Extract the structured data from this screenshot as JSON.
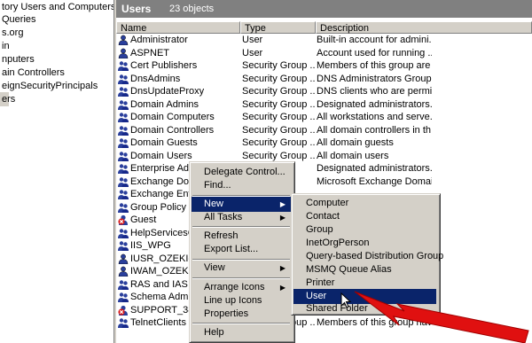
{
  "tree": {
    "items": [
      "tory Users and Computers [ex",
      "Queries",
      "s.org",
      "in",
      "nputers",
      "ain Controllers",
      "eignSecurityPrincipals",
      "ers"
    ]
  },
  "title": {
    "name": "Users",
    "count": "23 objects"
  },
  "columns": [
    "Name",
    "Type",
    "Description"
  ],
  "rows": [
    {
      "name": "Administrator",
      "type": "User",
      "desc": "Built-in account for admini...",
      "icon": "user-icon"
    },
    {
      "name": "ASPNET",
      "type": "User",
      "desc": "Account used for running ...",
      "icon": "user-icon"
    },
    {
      "name": "Cert Publishers",
      "type": "Security Group ...",
      "desc": "Members of this group are ...",
      "icon": "group-icon"
    },
    {
      "name": "DnsAdmins",
      "type": "Security Group ...",
      "desc": "DNS Administrators Group",
      "icon": "group-icon"
    },
    {
      "name": "DnsUpdateProxy",
      "type": "Security Group ...",
      "desc": "DNS clients who are permi...",
      "icon": "group-icon"
    },
    {
      "name": "Domain Admins",
      "type": "Security Group ...",
      "desc": "Designated administrators...",
      "icon": "group-icon"
    },
    {
      "name": "Domain Computers",
      "type": "Security Group ...",
      "desc": "All workstations and serve...",
      "icon": "group-icon"
    },
    {
      "name": "Domain Controllers",
      "type": "Security Group ...",
      "desc": "All domain controllers in th...",
      "icon": "group-icon"
    },
    {
      "name": "Domain Guests",
      "type": "Security Group ...",
      "desc": "All domain guests",
      "icon": "group-icon"
    },
    {
      "name": "Domain Users",
      "type": "Security Group ...",
      "desc": "All domain users",
      "icon": "group-icon"
    },
    {
      "name": "Enterprise Admi",
      "type": "",
      "desc": "Designated administrators...",
      "icon": "group-icon"
    },
    {
      "name": "Exchange Doma",
      "type": "",
      "desc": "Microsoft Exchange Domai...",
      "icon": "group-icon"
    },
    {
      "name": "Exchange Enter",
      "type": "",
      "desc": "",
      "icon": "group-icon"
    },
    {
      "name": "Group Policy Cre",
      "type": "",
      "desc": "",
      "icon": "group-icon"
    },
    {
      "name": "Guest",
      "type": "",
      "desc": "",
      "icon": "disabled-user-icon"
    },
    {
      "name": "HelpServicesGro",
      "type": "",
      "desc": "",
      "icon": "group-icon"
    },
    {
      "name": "IIS_WPG",
      "type": "",
      "desc": "",
      "icon": "group-icon"
    },
    {
      "name": "IUSR_OZEKI-EZ",
      "type": "",
      "desc": "",
      "icon": "user-icon"
    },
    {
      "name": "IWAM_OZEKI-EZ",
      "type": "",
      "desc": "",
      "icon": "user-icon"
    },
    {
      "name": "RAS and IAS Se",
      "type": "",
      "desc": "",
      "icon": "group-icon"
    },
    {
      "name": "Schema Admins",
      "type": "",
      "desc": "",
      "icon": "group-icon"
    },
    {
      "name": "SUPPORT_3889",
      "type": "",
      "desc": "",
      "icon": "disabled-user-icon"
    },
    {
      "name": "TelnetClients",
      "type": "Security Group ...",
      "desc": "Members of this group hav...",
      "icon": "group-icon"
    }
  ],
  "context_menu": {
    "items": [
      "Delegate Control...",
      "Find...",
      "New",
      "All Tasks",
      "Refresh",
      "Export List...",
      "View",
      "Arrange Icons",
      "Line up Icons",
      "Properties",
      "Help"
    ]
  },
  "submenu": {
    "items": [
      "Computer",
      "Contact",
      "Group",
      "InetOrgPerson",
      "Query-based Distribution Group",
      "MSMQ Queue Alias",
      "Printer",
      "User",
      "Shared Folder"
    ]
  },
  "colors": {
    "highlight": "#0a246a",
    "arrow": "#e01010",
    "titlebar": "#808080"
  }
}
